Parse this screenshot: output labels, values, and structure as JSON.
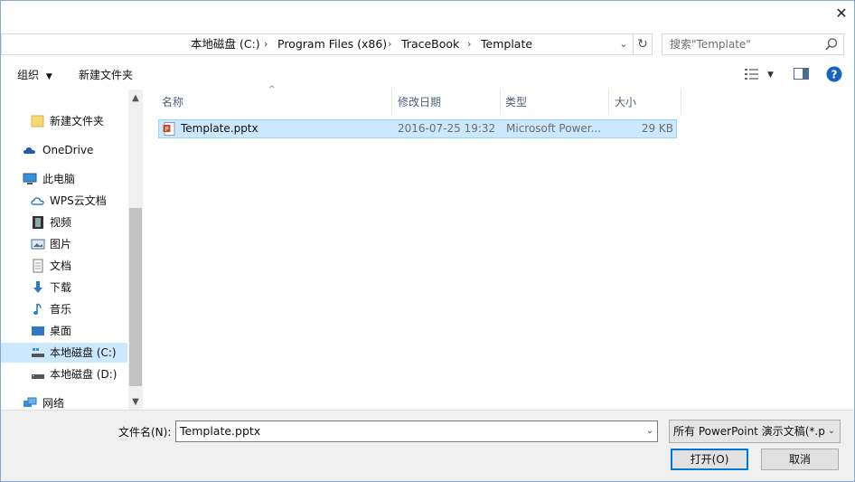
{
  "window": {
    "close_glyph": "✕"
  },
  "address_bar": {
    "crumbs": [
      "本地磁盘 (C:)",
      "Program Files (x86)",
      "TraceBook",
      "Template"
    ],
    "separator": "›"
  },
  "search": {
    "placeholder": "搜索\"Template\""
  },
  "toolbar": {
    "organize_label": "组织",
    "new_folder_label": "新建文件夹"
  },
  "nav": {
    "items": [
      {
        "label": "新建文件夹",
        "icon": "folder-icon"
      },
      {
        "label": "OneDrive",
        "icon": "cloud-icon"
      },
      {
        "label": "此电脑",
        "icon": "computer-icon"
      },
      {
        "label": "WPS云文档",
        "icon": "cloud-icon"
      },
      {
        "label": "视频",
        "icon": "video-icon"
      },
      {
        "label": "图片",
        "icon": "picture-icon"
      },
      {
        "label": "文档",
        "icon": "document-icon"
      },
      {
        "label": "下载",
        "icon": "download-icon"
      },
      {
        "label": "音乐",
        "icon": "music-icon"
      },
      {
        "label": "桌面",
        "icon": "desktop-icon"
      },
      {
        "label": "本地磁盘 (C:)",
        "icon": "drive-icon",
        "selected": true
      },
      {
        "label": "本地磁盘 (D:)",
        "icon": "drive-icon"
      },
      {
        "label": "网络",
        "icon": "network-icon"
      }
    ]
  },
  "file_list": {
    "columns": {
      "name": "名称",
      "modified": "修改日期",
      "type": "类型",
      "size": "大小"
    },
    "rows": [
      {
        "name": "Template.pptx",
        "modified": "2016-07-25 19:32",
        "type": "Microsoft Power...",
        "size": "29 KB",
        "selected": true
      }
    ]
  },
  "bottom": {
    "filename_label": "文件名(N):",
    "filename_value": "Template.pptx",
    "filter_value": "所有 PowerPoint 演示文稿(*.p",
    "open_label": "打开(O)",
    "cancel_label": "取消"
  },
  "colors": {
    "selection": "#cce8ff",
    "selection_border": "#99d1ff",
    "accent": "#0078d7"
  }
}
